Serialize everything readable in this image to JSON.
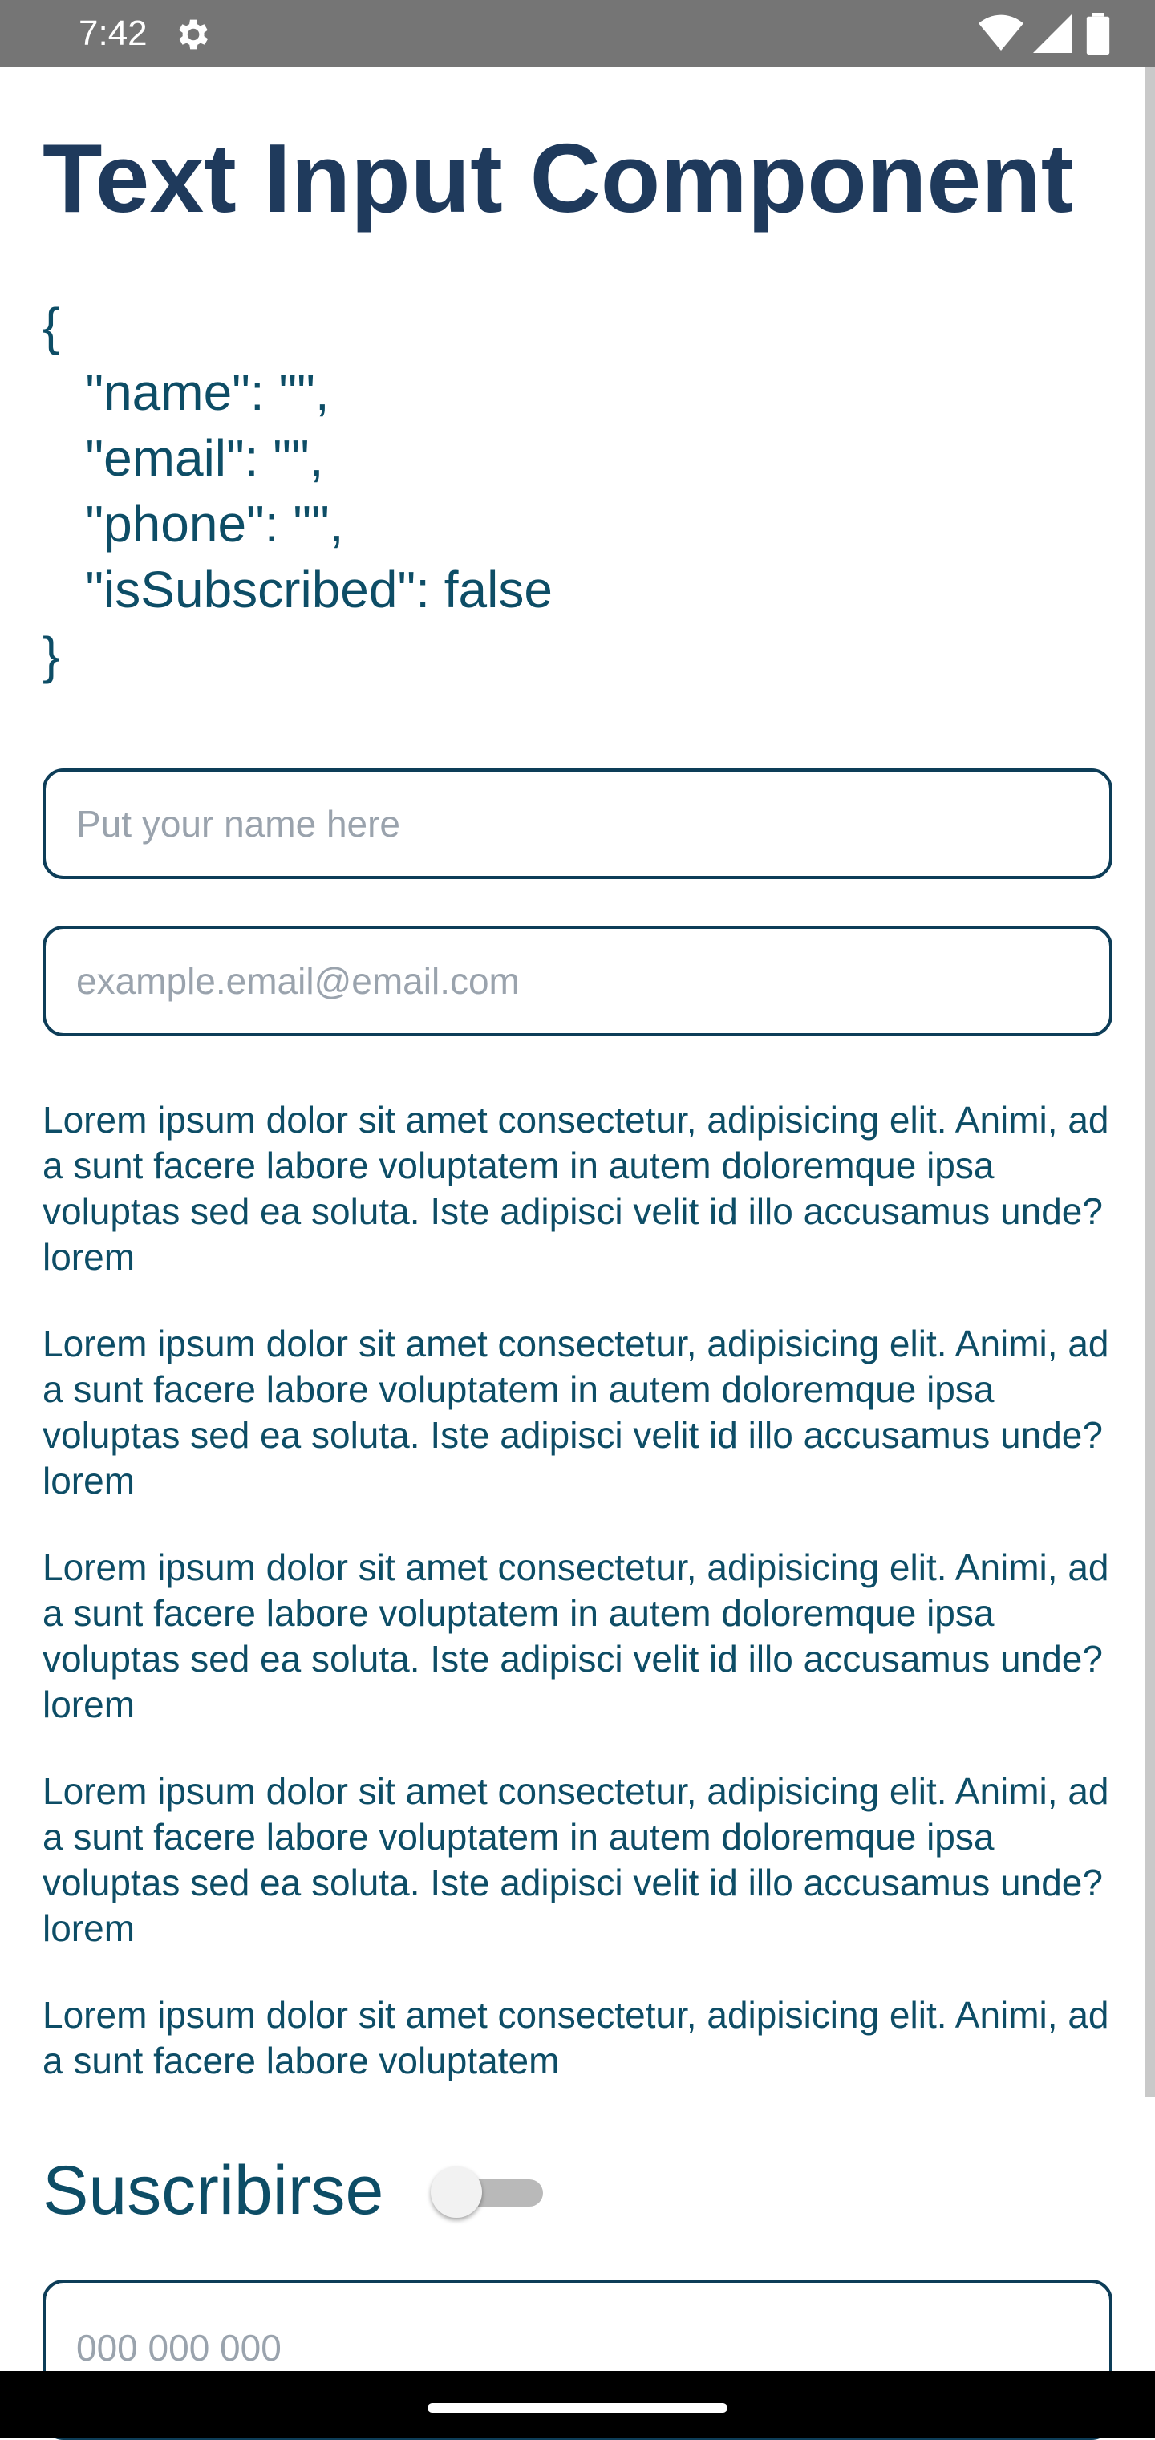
{
  "status_bar": {
    "time": "7:42",
    "icons": [
      "settings-gear-icon",
      "wifi-icon",
      "cellular-signal-icon",
      "battery-icon"
    ],
    "background": "#757575"
  },
  "page": {
    "title": "Text Input Component",
    "json_display": "{\n   \"name\": \"\",\n   \"email\": \"\",\n   \"phone\": \"\",\n   \"isSubscribed\": false\n}",
    "name_input": {
      "value": "",
      "placeholder": "Put your name here"
    },
    "email_input": {
      "value": "",
      "placeholder": "example.email@email.com"
    },
    "paragraphs": [
      "Lorem ipsum dolor sit amet consectetur, adipisicing elit. Animi, ad a sunt facere labore voluptatem in autem doloremque ipsa voluptas sed ea soluta. Iste adipisci velit id illo accusamus unde? lorem",
      "Lorem ipsum dolor sit amet consectetur, adipisicing elit. Animi, ad a sunt facere labore voluptatem in autem doloremque ipsa voluptas sed ea soluta. Iste adipisci velit id illo accusamus unde? lorem",
      "Lorem ipsum dolor sit amet consectetur, adipisicing elit. Animi, ad a sunt facere labore voluptatem in autem doloremque ipsa voluptas sed ea soluta. Iste adipisci velit id illo accusamus unde? lorem",
      "Lorem ipsum dolor sit amet consectetur, adipisicing elit. Animi, ad a sunt facere labore voluptatem in autem doloremque ipsa voluptas sed ea soluta. Iste adipisci velit id illo accusamus unde? lorem",
      "Lorem ipsum dolor sit amet consectetur, adipisicing elit. Animi, ad a sunt facere labore voluptatem"
    ],
    "subscribe": {
      "label": "Suscribirse",
      "enabled": false
    },
    "phone_input": {
      "value": "",
      "placeholder": "000 000 000"
    }
  },
  "colors": {
    "title": "#1f3a5c",
    "text": "#0d4d66",
    "input_border": "#0d3d58",
    "placeholder": "#9aa3ad"
  }
}
